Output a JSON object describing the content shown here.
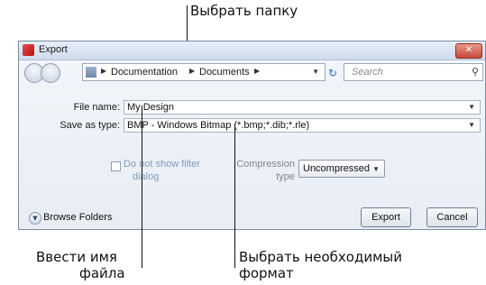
{
  "annotations": {
    "top": "Выбрать папку",
    "left_line1": "Ввести имя",
    "left_line2": "файла",
    "right_line1": "Выбрать необходимый",
    "right_line2": "формат"
  },
  "dialog": {
    "title": "Export",
    "close_glyph": "✕",
    "breadcrumb": [
      "Documentation",
      "Documents"
    ],
    "search_placeholder": "Search",
    "file_name_label": "File name:",
    "file_name_value": "My Design",
    "save_type_label": "Save as type:",
    "save_type_value": "BMP - Windows Bitmap (*.bmp;*.dib;*.rle)",
    "filter_checkbox_label_line1": "Do not show filter",
    "filter_checkbox_label_line2": "dialog",
    "compression_label_line1": "Compression",
    "compression_label_line2": "type",
    "compression_value": "Uncompressed",
    "browse_folders": "Browse Folders",
    "export_button": "Export",
    "cancel_button": "Cancel"
  },
  "icons": [
    "export-app-icon",
    "back-arrow-icon",
    "forward-arrow-icon",
    "folder-icon",
    "refresh-icon",
    "search-icon",
    "chevron-down-icon",
    "close-icon",
    "expand-icon"
  ],
  "colors": {
    "title_bg": "#cfdced",
    "close_red": "#c9463a",
    "link_blue": "#7f9bbc"
  }
}
